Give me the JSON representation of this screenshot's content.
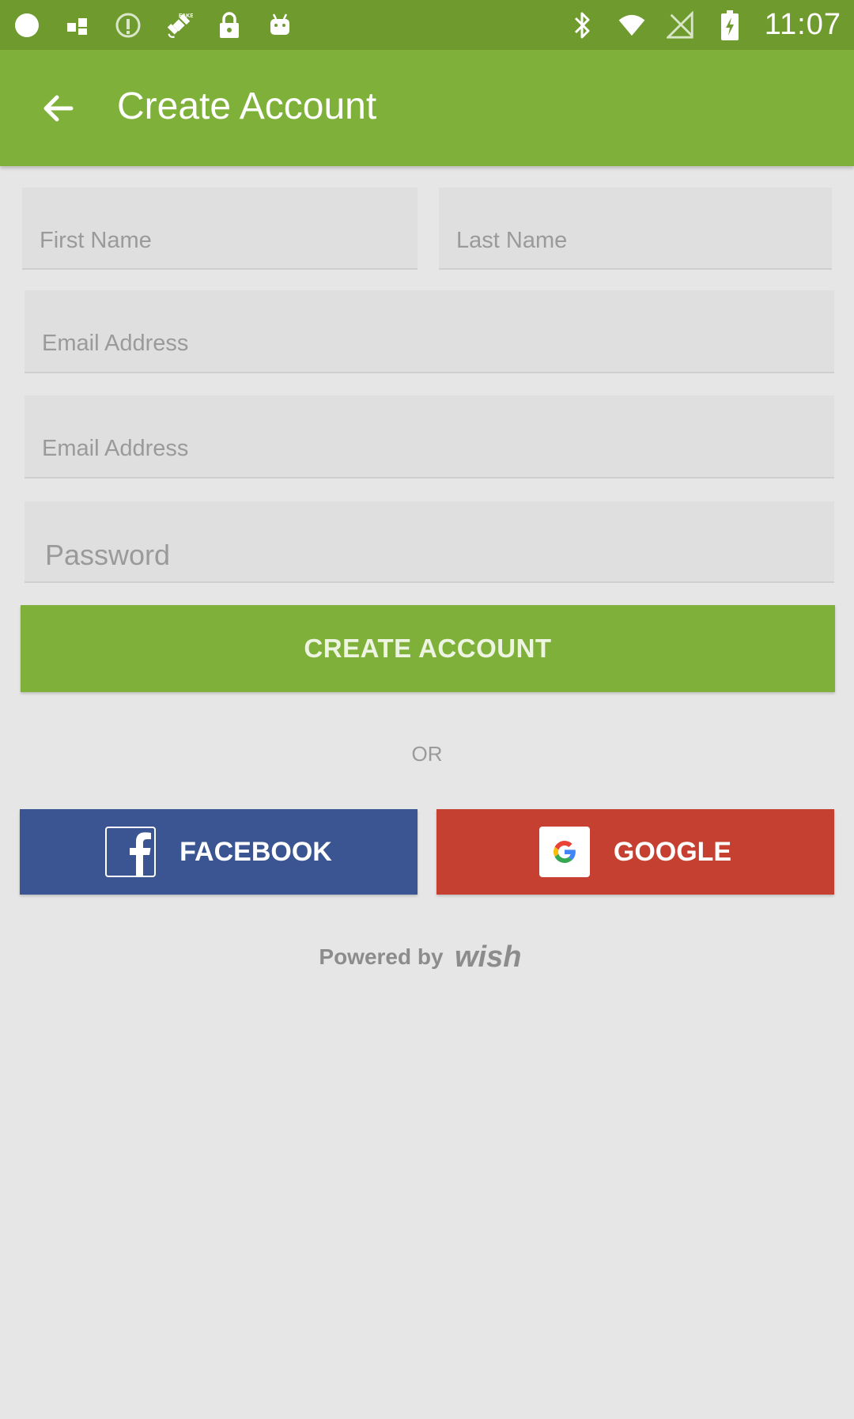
{
  "status_bar": {
    "time": "11:07",
    "icons": [
      "circle-icon",
      "grid-icon",
      "info-icon",
      "satellite-icon",
      "lock-icon",
      "android-icon",
      "bluetooth-icon",
      "wifi-icon",
      "no-signal-icon",
      "battery-charging-icon"
    ]
  },
  "toolbar": {
    "back_icon": "arrow-left-icon",
    "title": "Create Account"
  },
  "form": {
    "first_name": {
      "placeholder": "First Name",
      "value": ""
    },
    "last_name": {
      "placeholder": "Last Name",
      "value": ""
    },
    "email": {
      "placeholder": "Email Address",
      "value": ""
    },
    "email_confirm": {
      "placeholder": "Email Address",
      "value": ""
    },
    "password": {
      "placeholder": "Password",
      "value": ""
    }
  },
  "buttons": {
    "create_account": "CREATE ACCOUNT",
    "or": "OR",
    "facebook": "FACEBOOK",
    "google": "GOOGLE"
  },
  "footer": {
    "powered_by": "Powered by",
    "brand": "wish"
  },
  "colors": {
    "status_bar": "#6f9b2e",
    "toolbar": "#7fb13a",
    "primary_button": "#7fb13a",
    "facebook": "#3b5592",
    "google": "#c54030",
    "background": "#e6e6e6"
  }
}
